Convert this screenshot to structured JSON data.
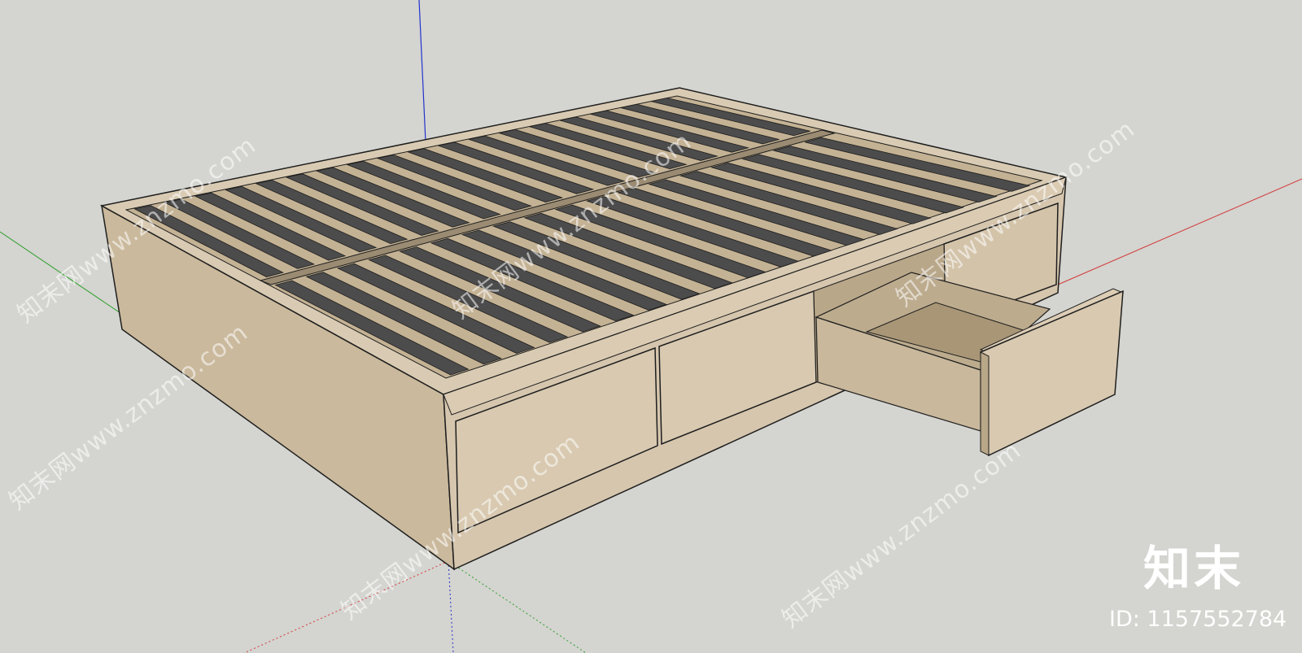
{
  "app": {
    "name": "SketchUp model viewport",
    "scene_subject": "platform bed frame with slats and pull-out drawer"
  },
  "colors": {
    "background": "#d4d4d0",
    "wood_light": "#d6c6ae",
    "wood_side": "#c8b698",
    "wood_shadow": "#b7a486",
    "slat_dark": "#4c4c4c",
    "edge": "#1e1e1e",
    "axis_blue": "#2233cc",
    "axis_red": "#d23a3a",
    "axis_green": "#2aa02a"
  },
  "watermark": {
    "text": "知末网www.znzmo.com",
    "logo_text": "知末",
    "id_label": "ID: 1157552784"
  },
  "icons": [
    "axis-origin-icon"
  ]
}
